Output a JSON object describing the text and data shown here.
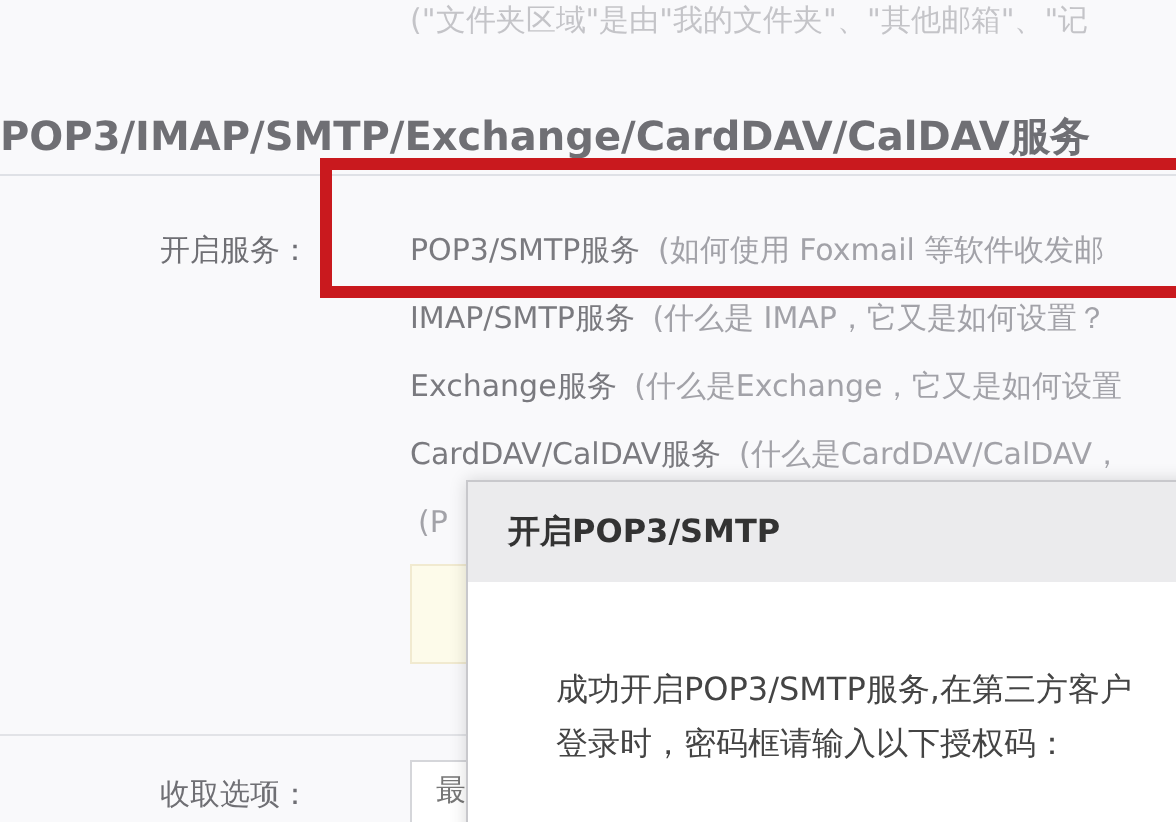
{
  "folder_note": "(\"文件夹区域\"是由\"我的文件夹\"、\"其他邮箱\"、\"记",
  "section_title": "POP3/IMAP/SMTP/Exchange/CardDAV/CalDAV服务",
  "services": {
    "label": "开启服务：",
    "lines": [
      {
        "name": "POP3/SMTP服务",
        "note": "(如何使用 Foxmail 等软件收发邮"
      },
      {
        "name": "IMAP/SMTP服务",
        "note": "(什么是 IMAP，它又是如何设置？"
      },
      {
        "name": "Exchange服务",
        "note": "(什么是Exchange，它又是如何设置"
      },
      {
        "name": "CardDAV/CalDAV服务",
        "note": "(什么是CardDAV/CalDAV，"
      },
      {
        "note": "(P"
      }
    ]
  },
  "fetch_options": {
    "label": "收取选项：",
    "value": "最"
  },
  "dialog": {
    "title": "开启POP3/SMTP",
    "message_lines": [
      "成功开启POP3/SMTP服务,在第三方客户",
      "登录时，密码框请输入以下授权码："
    ]
  }
}
